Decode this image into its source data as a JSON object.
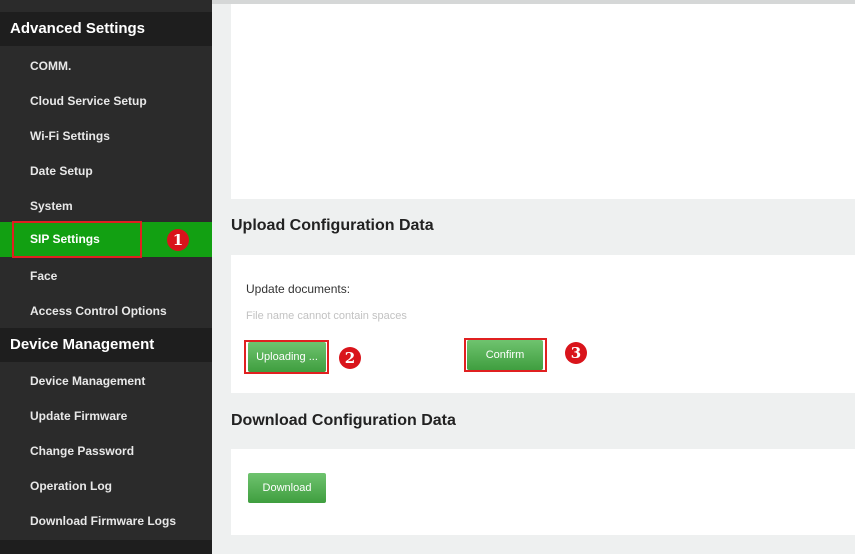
{
  "sidebar": {
    "groups": [
      {
        "title": "Advanced Settings",
        "items": [
          {
            "label": "COMM."
          },
          {
            "label": "Cloud Service Setup"
          },
          {
            "label": "Wi-Fi Settings"
          },
          {
            "label": "Date Setup"
          },
          {
            "label": "System"
          },
          {
            "label": "SIP Settings",
            "active": true
          },
          {
            "label": "Face"
          },
          {
            "label": "Access Control Options"
          }
        ]
      },
      {
        "title": "Device Management",
        "items": [
          {
            "label": "Device Management"
          },
          {
            "label": "Update Firmware"
          },
          {
            "label": "Change Password"
          },
          {
            "label": "Operation Log"
          },
          {
            "label": "Download Firmware Logs"
          }
        ]
      }
    ]
  },
  "upload_section": {
    "title": "Upload Configuration Data",
    "update_label": "Update documents:",
    "hint": "File name cannot contain spaces",
    "upload_button": "Uploading ...",
    "confirm_button": "Confirm"
  },
  "download_section": {
    "title": "Download Configuration Data",
    "download_button": "Download"
  },
  "annotations": {
    "step1": "1",
    "step2": "2",
    "step3": "3"
  },
  "colors": {
    "sidebar_bg": "#2b2b2b",
    "group_header_bg": "#1e1e1e",
    "active_item_bg": "#12a012",
    "button_green": "#4caf50",
    "annotation_red": "#e02020",
    "main_bg": "#eef0f0"
  }
}
